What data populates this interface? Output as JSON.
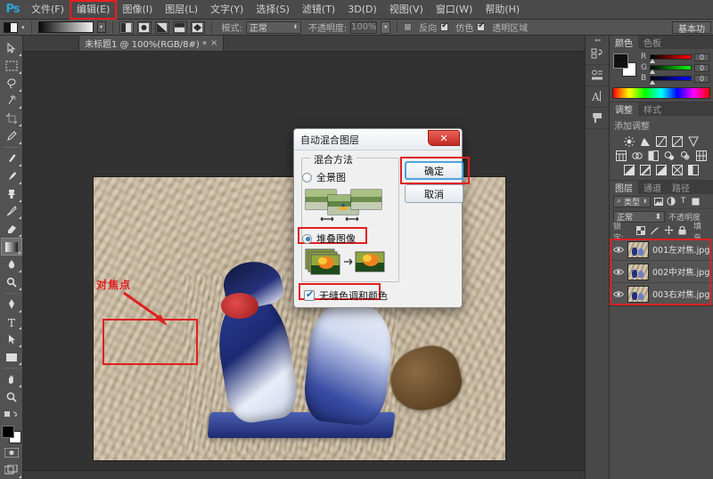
{
  "app": {
    "name": "Ps"
  },
  "menubar": {
    "items": [
      {
        "label": "文件(F)",
        "highlighted": false
      },
      {
        "label": "编辑(E)",
        "highlighted": true
      },
      {
        "label": "图像(I)",
        "highlighted": false
      },
      {
        "label": "图层(L)",
        "highlighted": false
      },
      {
        "label": "文字(Y)",
        "highlighted": false
      },
      {
        "label": "选择(S)",
        "highlighted": false
      },
      {
        "label": "滤镜(T)",
        "highlighted": false
      },
      {
        "label": "3D(D)",
        "highlighted": false
      },
      {
        "label": "视图(V)",
        "highlighted": false
      },
      {
        "label": "窗口(W)",
        "highlighted": false
      },
      {
        "label": "帮助(H)",
        "highlighted": false
      }
    ]
  },
  "options_bar": {
    "mode_label": "模式:",
    "mode_value": "正常",
    "opacity_label": "不透明度:",
    "opacity_value": "100%",
    "reverse_label": "反向",
    "dither_label": "仿色",
    "transparency_label": "透明区域",
    "workspace_label": "基本功"
  },
  "document": {
    "tab_title": "未标题1 @ 100%(RGB/8#) *",
    "close_glyph": "×"
  },
  "canvas": {
    "annotation_text": "对焦点"
  },
  "dialog": {
    "title": "自动混合图层",
    "close_glyph": "✕",
    "group_title": "混合方法",
    "option_panorama": "全景图",
    "option_stack": "堆叠图像",
    "selected_option": "堆叠图像",
    "checkbox_seamless": "无缝色调和颜色",
    "checkbox_seamless_checked": true,
    "button_ok": "确定",
    "button_cancel": "取消"
  },
  "panels": {
    "color": {
      "tabs": [
        "颜色",
        "色板"
      ],
      "active_tab": "颜色",
      "channels": [
        {
          "name": "R",
          "value": "0"
        },
        {
          "name": "G",
          "value": "0"
        },
        {
          "name": "B",
          "value": "0"
        }
      ]
    },
    "adjustments": {
      "tabs": [
        "调整",
        "样式"
      ],
      "active_tab": "调整",
      "label": "添加调整"
    },
    "layers": {
      "tabs": [
        "图层",
        "通道",
        "路径"
      ],
      "active_tab": "图层",
      "filter_label": "类型",
      "blend_mode": "正常",
      "opacity_label": "不透明度",
      "lock_label": "锁定:",
      "fill_label": "填充",
      "rows": [
        {
          "name": "001左对焦.jpg",
          "visible": true
        },
        {
          "name": "002中对焦.jpg",
          "visible": true
        },
        {
          "name": "003右对焦.jpg",
          "visible": true
        }
      ]
    }
  },
  "colors": {
    "annotation_red": "#e02020",
    "accent_blue": "#4aa3e0",
    "app_bg": "#3a3a3a",
    "panel_bg": "#4c4c4c"
  }
}
